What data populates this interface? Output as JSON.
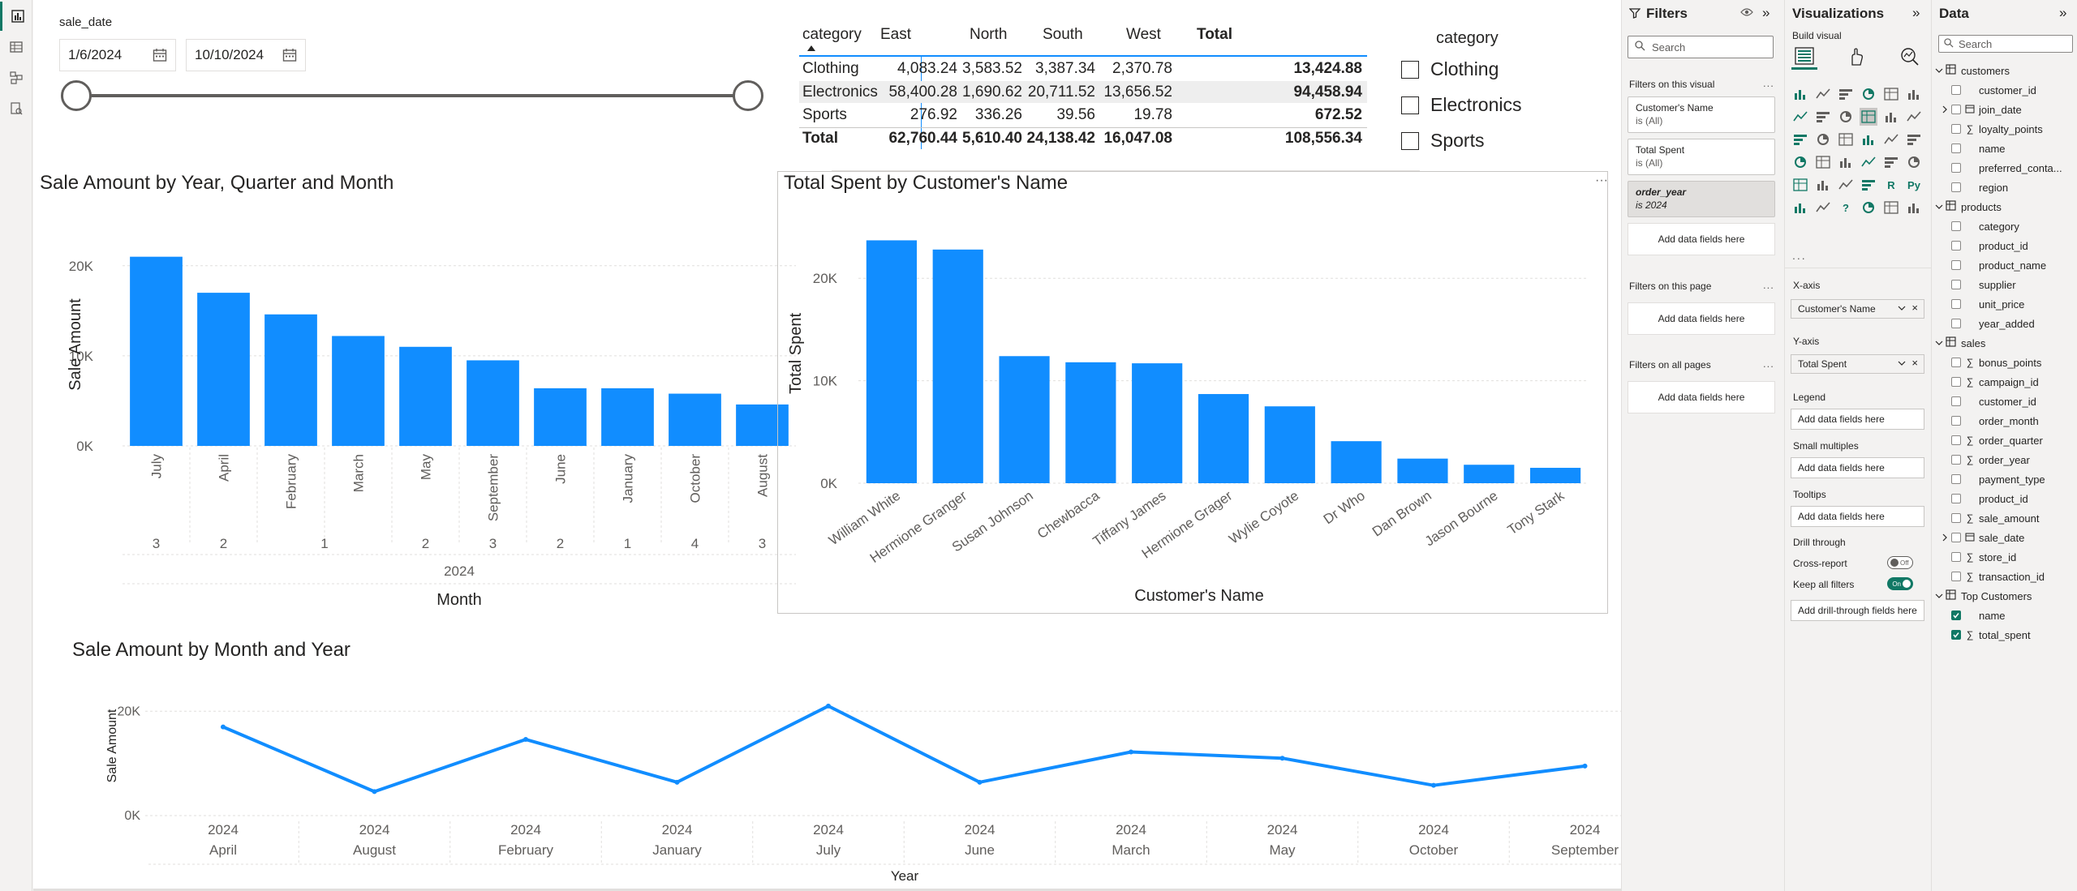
{
  "app": {
    "left_nav": [
      "report-view",
      "table-view",
      "model-view",
      "dax-query-view"
    ]
  },
  "date_slicer": {
    "title": "sale_date",
    "start": "1/6/2024",
    "end": "10/10/2024"
  },
  "matrix": {
    "header": [
      "category",
      "East",
      "North",
      "South",
      "West",
      "Total"
    ],
    "rows": [
      [
        "Clothing",
        "4,083.24",
        "3,583.52",
        "3,387.34",
        "2,370.78",
        "13,424.88"
      ],
      [
        "Electronics",
        "58,400.28",
        "1,690.62",
        "20,711.52",
        "13,656.52",
        "94,458.94"
      ],
      [
        "Sports",
        "276.92",
        "336.26",
        "39.56",
        "19.78",
        "672.52"
      ]
    ],
    "total": [
      "Total",
      "62,760.44",
      "5,610.40",
      "24,138.42",
      "16,047.08",
      "108,556.34"
    ]
  },
  "category_slicer": {
    "title": "category",
    "options": [
      "Clothing",
      "Electronics",
      "Sports"
    ]
  },
  "chart_data": [
    {
      "type": "bar",
      "title": "Sale Amount by Year, Quarter and Month",
      "xlabel": "Month",
      "ylabel": "Sale Amount",
      "categories": [
        "July",
        "April",
        "February",
        "March",
        "May",
        "September",
        "June",
        "January",
        "October",
        "August"
      ],
      "quarters": [
        "3",
        "2",
        "1",
        "2",
        "3",
        "2",
        "1",
        "4",
        "3"
      ],
      "quarter_groups": [
        [
          "3",
          1
        ],
        [
          "2",
          1
        ],
        [
          "1",
          2
        ],
        [
          "2",
          1
        ],
        [
          "3",
          1
        ],
        [
          "2",
          1
        ],
        [
          "1",
          1
        ],
        [
          "4",
          1
        ],
        [
          "3",
          1
        ]
      ],
      "year": "2024",
      "values": [
        21000,
        17000,
        14600,
        12200,
        11000,
        9500,
        6400,
        6400,
        5800,
        4600
      ],
      "yticks": [
        "0K",
        "10K",
        "20K"
      ],
      "ylim": [
        0,
        22500
      ]
    },
    {
      "type": "bar",
      "title": "Total Spent by Customer's Name",
      "xlabel": "Customer's Name",
      "ylabel": "Total Spent",
      "categories": [
        "William White",
        "Hermione Granger",
        "Susan Johnson",
        "Chewbacca",
        "Tiffany James",
        "Hermione Grager",
        "Wylie Coyote",
        "Dr Who",
        "Dan Brown",
        "Jason Bourne",
        "Tony Stark"
      ],
      "values": [
        23700,
        22800,
        12400,
        11800,
        11700,
        8700,
        7500,
        4100,
        2400,
        1800,
        1500
      ],
      "yticks": [
        "0K",
        "10K",
        "20K"
      ],
      "ylim": [
        0,
        25000
      ]
    },
    {
      "type": "line",
      "title": "Sale Amount by Month and Year",
      "xlabel": "Year",
      "ylabel": "Sale Amount",
      "x_year": "2024",
      "categories": [
        "April",
        "August",
        "February",
        "January",
        "July",
        "June",
        "March",
        "May",
        "October",
        "September"
      ],
      "values": [
        17000,
        4600,
        14600,
        6400,
        21000,
        6400,
        12200,
        11000,
        5800,
        9500
      ],
      "yticks": [
        "0K",
        "20K"
      ],
      "ylim": [
        0,
        23000
      ]
    }
  ],
  "filters_pane": {
    "title": "Filters",
    "search_placeholder": "Search",
    "on_visual_label": "Filters on this visual",
    "cards": [
      {
        "name": "Customer's Name",
        "value": "is (All)"
      },
      {
        "name": "Total Spent",
        "value": "is (All)"
      },
      {
        "name": "order_year",
        "value": "is 2024"
      }
    ],
    "add_fields": "Add data fields here",
    "on_page_label": "Filters on this page",
    "on_all_label": "Filters on all pages"
  },
  "viz_pane": {
    "title": "Visualizations",
    "build_visual": "Build visual",
    "more": "...",
    "wells": [
      {
        "label": "X-axis",
        "field": "Customer's Name"
      },
      {
        "label": "Y-axis",
        "field": "Total Spent"
      }
    ],
    "legend": "Legend",
    "small_multiples": "Small multiples",
    "tooltips": "Tooltips",
    "add_fields": "Add data fields here",
    "drill_through": "Drill through",
    "cross_report": "Cross-report",
    "cross_report_state": "Off",
    "keep_all_filters": "Keep all filters",
    "keep_all_state": "On",
    "add_drill": "Add drill-through fields here"
  },
  "data_pane": {
    "title": "Data",
    "search_placeholder": "Search",
    "tables": [
      {
        "name": "customers",
        "fields": [
          {
            "name": "customer_id"
          },
          {
            "name": "join_date",
            "kind": "date"
          },
          {
            "name": "loyalty_points",
            "kind": "sum"
          },
          {
            "name": "name"
          },
          {
            "name": "preferred_conta..."
          },
          {
            "name": "region"
          }
        ]
      },
      {
        "name": "products",
        "fields": [
          {
            "name": "category"
          },
          {
            "name": "product_id"
          },
          {
            "name": "product_name"
          },
          {
            "name": "supplier"
          },
          {
            "name": "unit_price"
          },
          {
            "name": "year_added"
          }
        ]
      },
      {
        "name": "sales",
        "fields": [
          {
            "name": "bonus_points",
            "kind": "sum"
          },
          {
            "name": "campaign_id",
            "kind": "sum"
          },
          {
            "name": "customer_id"
          },
          {
            "name": "order_month"
          },
          {
            "name": "order_quarter",
            "kind": "sum"
          },
          {
            "name": "order_year",
            "kind": "sum"
          },
          {
            "name": "payment_type"
          },
          {
            "name": "product_id"
          },
          {
            "name": "sale_amount",
            "kind": "sum"
          },
          {
            "name": "sale_date",
            "kind": "date"
          },
          {
            "name": "store_id",
            "kind": "sum"
          },
          {
            "name": "transaction_id",
            "kind": "sum"
          }
        ]
      },
      {
        "name": "Top Customers",
        "fields": [
          {
            "name": "name",
            "checked": true
          },
          {
            "name": "total_spent",
            "kind": "sum",
            "checked": true
          }
        ]
      }
    ]
  },
  "colors": {
    "bar": "#118dff",
    "line": "#118dff",
    "accent": "#117865"
  }
}
